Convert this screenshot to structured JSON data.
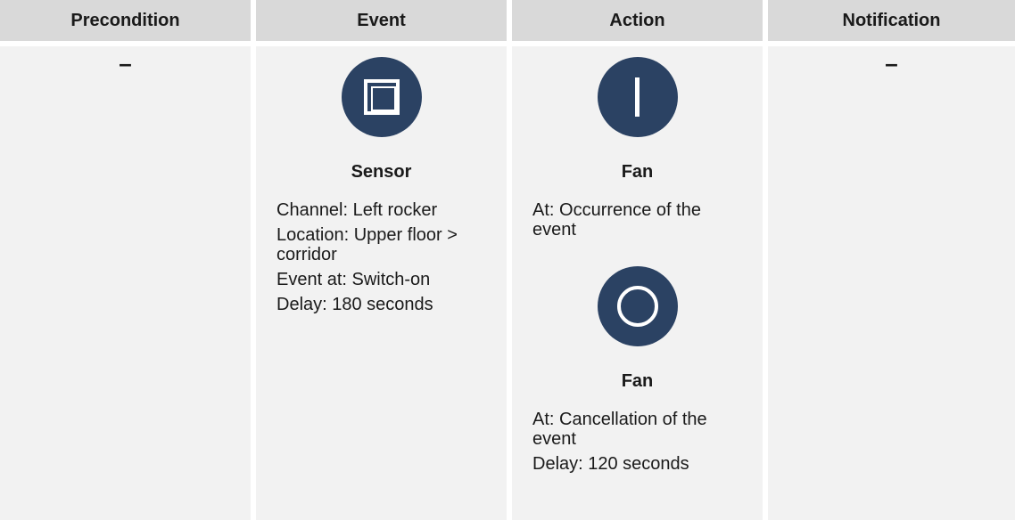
{
  "headers": [
    "Precondition",
    "Event",
    "Action",
    "Notification"
  ],
  "precondition": {
    "value": "–"
  },
  "event": {
    "icon": "sensor-square-icon",
    "title": "Sensor",
    "lines": [
      "Channel: Left rocker",
      "Location: Upper floor > corridor",
      "Event at: Switch-on",
      "Delay: 180 seconds"
    ]
  },
  "action": {
    "items": [
      {
        "icon": "power-on-icon",
        "title": "Fan",
        "lines": [
          "At: Occurrence of the event"
        ]
      },
      {
        "icon": "power-off-icon",
        "title": "Fan",
        "lines": [
          "At: Cancellation of the event",
          "Delay: 120 seconds"
        ]
      }
    ]
  },
  "notification": {
    "value": "–"
  },
  "colors": {
    "header_bg": "#d9d9d9",
    "body_bg": "#f2f2f2",
    "icon_bg": "#2b4263"
  }
}
